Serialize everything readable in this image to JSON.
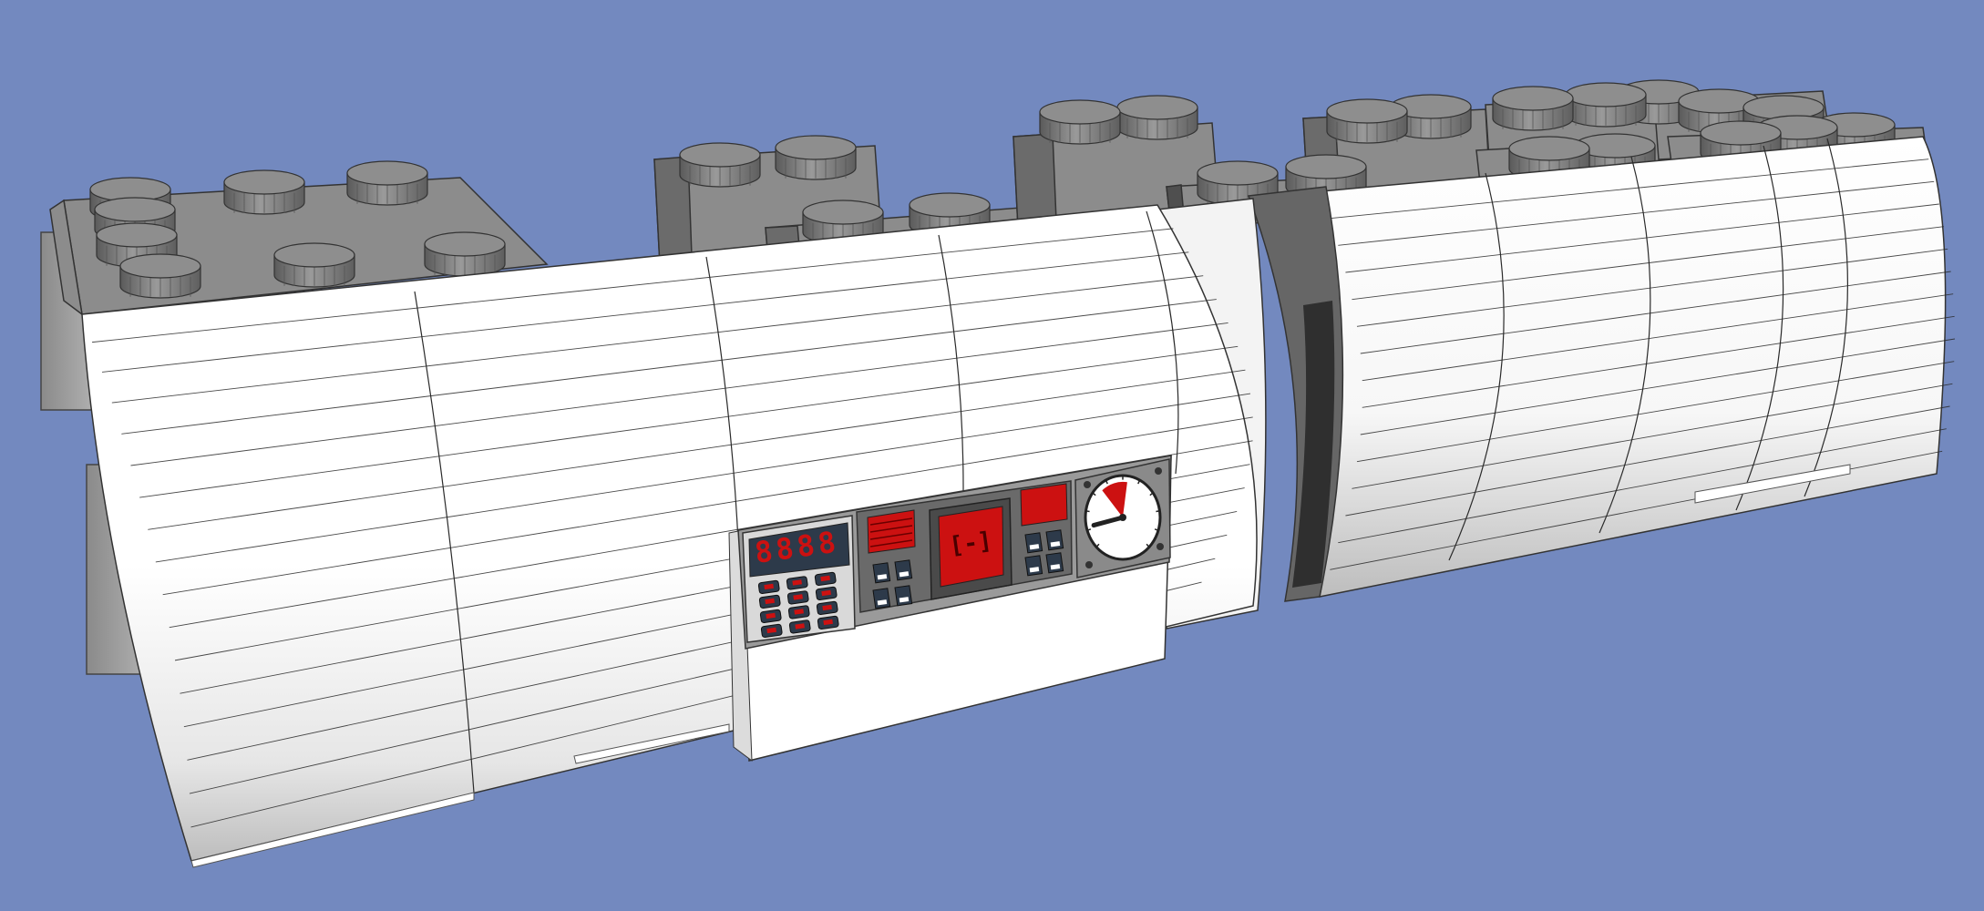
{
  "scene": {
    "background_color": "#7389bf",
    "colors": {
      "shell": "#ffffff",
      "shell_shadow": "#d6d6d6",
      "brick": "#8c8c8c",
      "brick_dark": "#4f4f4f",
      "panel": "#5f5f5f",
      "display_red": "#cc1111",
      "line": "#2a2a2a"
    },
    "keypad": {
      "display_digits": "8888",
      "key_rows": 4,
      "key_cols": 3
    },
    "gauge": {
      "needle_fraction": 0.35,
      "red_zone_fraction": 0.18
    }
  }
}
